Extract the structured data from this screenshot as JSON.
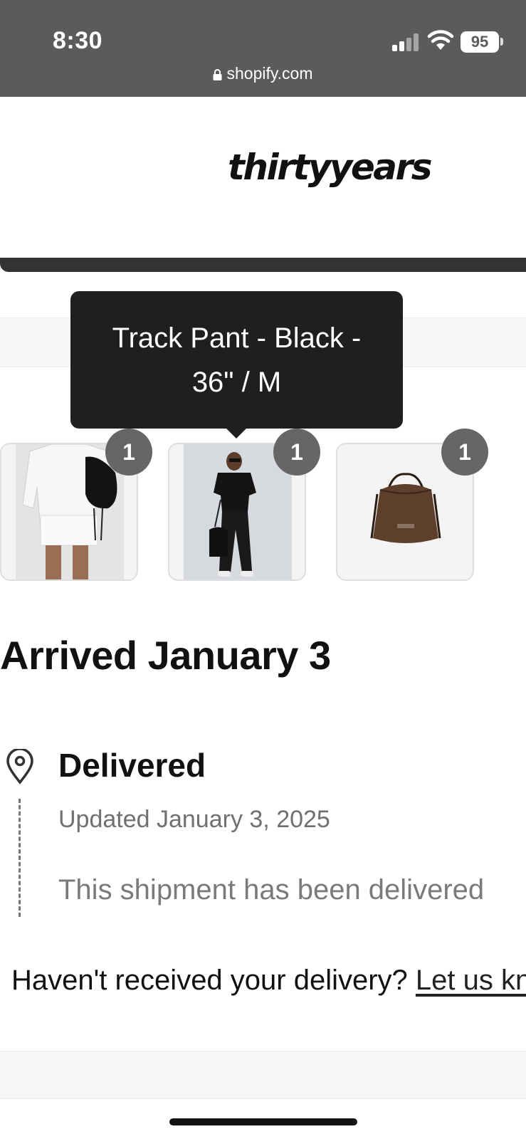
{
  "status_bar": {
    "time": "8:30",
    "battery": "95",
    "url": "shopify.com"
  },
  "brand": {
    "logo_text": "thirtyyears"
  },
  "tooltip": {
    "line1": "Track Pant - Black -",
    "line2": "36\" / M"
  },
  "items": [
    {
      "quantity": "1",
      "image": "white-shirt-shorts-with-black-drawstring-bag"
    },
    {
      "quantity": "1",
      "image": "black-tee-and-track-pant-with-bag"
    },
    {
      "quantity": "1",
      "image": "brown-drawstring-bag"
    }
  ],
  "shipment": {
    "heading": "Arrived January 3",
    "status": "Delivered",
    "updated": "Updated January 3, 2025",
    "message": "This shipment has been delivered",
    "help_prompt": "Haven't received your delivery?",
    "help_link": "Let us know"
  },
  "colors": {
    "status_bar": "#5b5b5b",
    "badge": "#666666",
    "tooltip": "#1f1f1f",
    "header_bar": "#333333"
  }
}
